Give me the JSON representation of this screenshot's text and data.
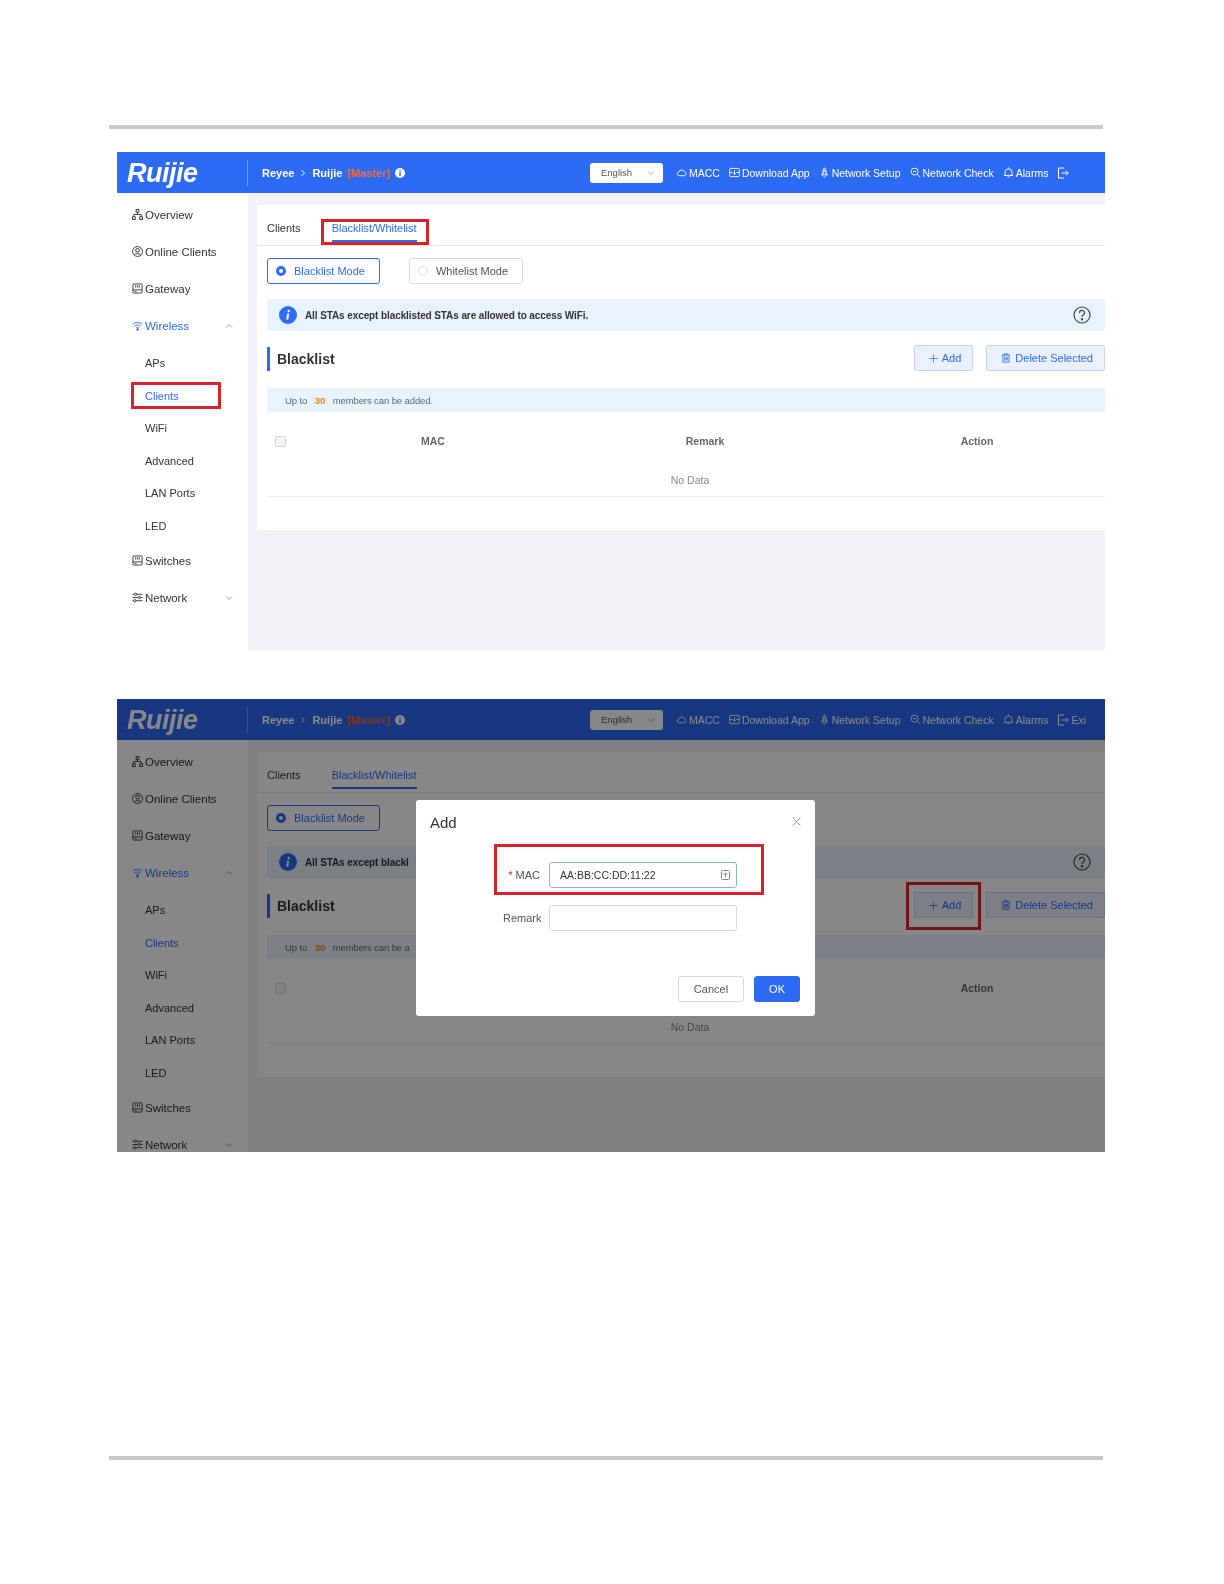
{
  "screens": [
    {
      "header": {
        "logo": "Ruijie",
        "breadcrumb": [
          "Reyee",
          "Ruijie"
        ],
        "role": "[Master]",
        "language": "English",
        "nav": [
          {
            "label": "MACC"
          },
          {
            "label": "Download App"
          },
          {
            "label": "Network Setup"
          },
          {
            "label": "Network Check"
          },
          {
            "label": "Alarms"
          },
          {
            "kind": "icon"
          }
        ]
      },
      "sidebar": [
        {
          "label": "Overview",
          "selected": false
        },
        {
          "label": "Online Clients",
          "selected": false
        },
        {
          "label": "Gateway",
          "selected": false
        },
        {
          "label": "Wireless",
          "selected": true,
          "expanded": true,
          "children": [
            {
              "label": "APs",
              "selected": false,
              "highlighted": false
            },
            {
              "label": "Clients",
              "selected": true,
              "highlighted": true
            },
            {
              "label": "WiFi",
              "selected": false,
              "highlighted": false
            },
            {
              "label": "Advanced",
              "selected": false,
              "highlighted": false
            },
            {
              "label": "LAN Ports",
              "selected": false,
              "highlighted": false
            },
            {
              "label": "LED",
              "selected": false,
              "highlighted": false
            }
          ]
        },
        {
          "label": "Switches",
          "selected": false
        },
        {
          "label": "Network",
          "selected": false,
          "expanded": false
        }
      ],
      "tabs": [
        {
          "label": "Clients",
          "selected": false,
          "highlighted": false
        },
        {
          "label": "Blacklist/Whitelist",
          "selected": true,
          "highlighted": true
        }
      ],
      "modes": [
        {
          "label": "Blacklist Mode",
          "selected": true
        },
        {
          "label": "Whitelist Mode",
          "selected": false
        }
      ],
      "info": "All STAs except blacklisted STAs are allowed to access WiFi.",
      "section": {
        "title": "Blacklist",
        "buttons": [
          {
            "label": "Add",
            "highlighted": false
          },
          {
            "label": "Delete Selected",
            "highlighted": false
          }
        ]
      },
      "notice": "Up to **30** members can be added.",
      "table": {
        "all_checked": false,
        "columns": [
          {
            "kind": "mac",
            "label": "MAC"
          },
          {
            "kind": "remark",
            "label": "Remark"
          },
          {
            "kind": "action",
            "label": "Action"
          }
        ],
        "empty": "No Data"
      }
    },
    {
      "header": {
        "logo": "Ruijie",
        "breadcrumb": [
          "Reyee",
          "Ruijie"
        ],
        "role": "[Master]",
        "language": "English",
        "nav": [
          {
            "label": "MACC"
          },
          {
            "label": "Download App"
          },
          {
            "label": "Network Setup"
          },
          {
            "label": "Network Check"
          },
          {
            "label": "Alarms"
          },
          {
            "label": "Exi"
          }
        ]
      },
      "sidebar": [
        {
          "label": "Overview",
          "selected": false
        },
        {
          "label": "Online Clients",
          "selected": false
        },
        {
          "label": "Gateway",
          "selected": false
        },
        {
          "label": "Wireless",
          "selected": true,
          "expanded": true,
          "children": [
            {
              "label": "APs",
              "selected": false,
              "highlighted": false
            },
            {
              "label": "Clients",
              "selected": true,
              "highlighted": false
            },
            {
              "label": "WiFi",
              "selected": false,
              "highlighted": false
            },
            {
              "label": "Advanced",
              "selected": false,
              "highlighted": false
            },
            {
              "label": "LAN Ports",
              "selected": false,
              "highlighted": false
            },
            {
              "label": "LED",
              "selected": false,
              "highlighted": false
            }
          ]
        },
        {
          "label": "Switches",
          "selected": false
        },
        {
          "label": "Network",
          "selected": false,
          "expanded": false
        }
      ],
      "tabs": [
        {
          "label": "Clients",
          "selected": false,
          "highlighted": false
        },
        {
          "label": "Blacklist/Whitelist",
          "selected": true,
          "highlighted": false
        }
      ],
      "modes": [
        {
          "label": "Blacklist Mode",
          "selected": true
        }
      ],
      "info": "All STAs except blackl",
      "section": {
        "title": "Blacklist",
        "buttons": [
          {
            "label": "Add",
            "highlighted": true
          },
          {
            "label": "Delete Selected",
            "highlighted": false
          }
        ]
      },
      "notice": "Up to **30** members can be a",
      "table": {
        "all_checked": false,
        "columns": [
          {
            "kind": "action",
            "label": "Action"
          }
        ],
        "empty": "No Data"
      },
      "dialog": {
        "title": "Add",
        "fields": [
          {
            "label": "MAC",
            "required_mark": "*",
            "value": "AA:BB:CC:DD:11:22",
            "highlighted": true
          },
          {
            "label": "Remark",
            "highlighted": false
          }
        ],
        "buttons": [
          {
            "kind": "secondary",
            "label": "Cancel"
          },
          {
            "kind": "primary",
            "label": "OK"
          }
        ]
      }
    }
  ]
}
